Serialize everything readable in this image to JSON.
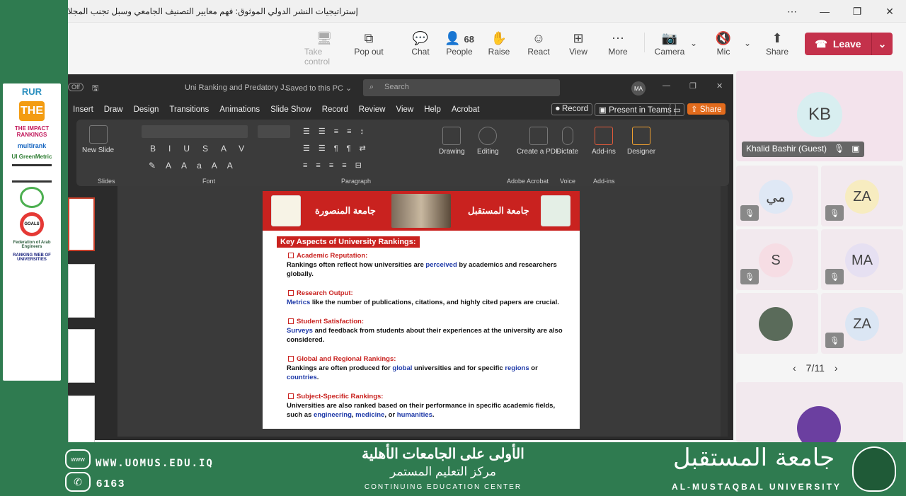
{
  "window": {
    "title": "إستراتيجيات النشر الدولي الموثوق: فهم معايير التصنيف الجامعي وسبل تجنب المجلات",
    "controls": [
      "⋯",
      "—",
      "❐",
      "✕"
    ]
  },
  "toolbar": {
    "items": [
      {
        "label": "Take control",
        "icon": "🖥"
      },
      {
        "label": "Pop out",
        "icon": "⧉"
      },
      {
        "label": "Chat",
        "icon": "💬"
      },
      {
        "label": "People",
        "icon": "👤",
        "count": "68"
      },
      {
        "label": "Raise",
        "icon": "✋"
      },
      {
        "label": "React",
        "icon": "☺"
      },
      {
        "label": "View",
        "icon": "⊞"
      },
      {
        "label": "More",
        "icon": "⋯"
      },
      {
        "label": "Camera",
        "icon": "📷"
      },
      {
        "label": "Mic",
        "icon": "🔇"
      },
      {
        "label": "Share",
        "icon": "⬆"
      }
    ],
    "leave": "Leave"
  },
  "ppt": {
    "autosave": "Off",
    "filename": "Uni Ranking and Predatory J...",
    "saved": "Saved to this PC ⌄",
    "search": "Search",
    "user": "MA",
    "menu": [
      "Insert",
      "Draw",
      "Design",
      "Transitions",
      "Animations",
      "Slide Show",
      "Record",
      "Review",
      "View",
      "Help",
      "Acrobat"
    ],
    "record_btn": "Record",
    "present_btn": "Present in Teams",
    "share_btn": "Share",
    "groups": {
      "slides": "Slides",
      "font": "Font",
      "paragraph": "Paragraph",
      "adobe": "Adobe Acrobat",
      "voice": "Voice",
      "addins": "Add-ins"
    },
    "buttons": {
      "new_slide": "New Slide",
      "drawing": "Drawing",
      "editing": "Editing",
      "create_pdf": "Create a PDF",
      "dictate": "Dictate",
      "addins": "Add-ins",
      "designer": "Designer"
    }
  },
  "slide": {
    "left_uni": "جامعة المنصورة",
    "right_uni": "جامعة المستقبل",
    "title": "Key Aspects of University Rankings:",
    "items": [
      {
        "h": "Academic Reputation:",
        "b1": "Rankings often reflect how universities are ",
        "hl": "perceived",
        "b2": " by academics and researchers globally."
      },
      {
        "h": "Research Output:",
        "hl": "Metrics",
        "b2": " like the number of publications, citations, and highly cited papers are crucial."
      },
      {
        "h": "Student Satisfaction:",
        "hl": "Surveys",
        "b2": " and feedback from students about their experiences at the university are also considered."
      },
      {
        "h": "Global and Regional Rankings:",
        "b1": "Rankings are often produced for ",
        "hl": "global",
        "b2": " universities and for specific ",
        "hl2": "regions",
        "b3": " or ",
        "hl3": "countries",
        "b4": "."
      },
      {
        "h": "Subject-Specific Rankings:",
        "b1": "Universities are also ranked based on their performance in specific academic fields, such as ",
        "hl": "engineering",
        "b2": ", ",
        "hl2": "medicine",
        "b3": ", or ",
        "hl3": "humanities",
        "b4": "."
      }
    ]
  },
  "gallery": {
    "main": {
      "initials": "KB",
      "name": "Khalid Bashir (Guest)"
    },
    "tiles": [
      "مي",
      "ZA",
      "S",
      "MA",
      "",
      "ZA"
    ],
    "pager": "7/11"
  },
  "sidebar_logos": [
    "RUR",
    "THE",
    "THE IMPACT RANKINGS",
    "multirank",
    "UI GreenMetric",
    "",
    "",
    "GOALS",
    "Federation of Arab Engineers",
    "RANKING WEB OF UNIVERSITIES"
  ],
  "banner": {
    "web": "WWW.UOMUS.EDU.IQ",
    "phone": "6163",
    "www_icon": "www",
    "ar1": "الأولى على الجامعات الأهلية",
    "ar2": "مركز التعليم المستمر",
    "en": "CONTINUING EDUCATION CENTER",
    "uni_ar": "جامعة المستقبل",
    "uni_en": "AL-MUSTAQBAL UNIVERSITY"
  }
}
